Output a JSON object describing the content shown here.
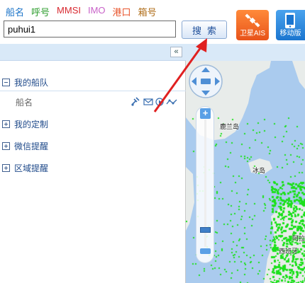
{
  "header": {
    "search_tabs": [
      {
        "label": "船名",
        "color": "#1a73c8"
      },
      {
        "label": "呼号",
        "color": "#2f9e2f"
      },
      {
        "label": "MMSI",
        "color": "#d8282f"
      },
      {
        "label": "IMO",
        "color": "#c862c8"
      },
      {
        "label": "港口",
        "color": "#e8532a"
      },
      {
        "label": "箱号",
        "color": "#b06e1a"
      }
    ],
    "search_value": "puhui1",
    "search_button_label": "搜索",
    "satellite_ais_label": "卫星AIS",
    "mobile_label": "移动版"
  },
  "panel": {
    "collapse_label": "«"
  },
  "sidebar": {
    "fleet_title": "我的船队",
    "ship_name_label": "船名",
    "custom_title": "我的定制",
    "wechat_title": "微信提醒",
    "area_title": "区域提醒"
  },
  "map": {
    "labels": [
      "鹿兰岛",
      "冰岛",
      "阿拉斯",
      "西班牙"
    ]
  },
  "colors": {
    "sea": "#aacbee",
    "land": "#e8ecea",
    "ship_dots": "#1ce01c",
    "arrow": "#e02020",
    "accent_orange": "#e8531a",
    "accent_blue": "#1b75cf"
  }
}
